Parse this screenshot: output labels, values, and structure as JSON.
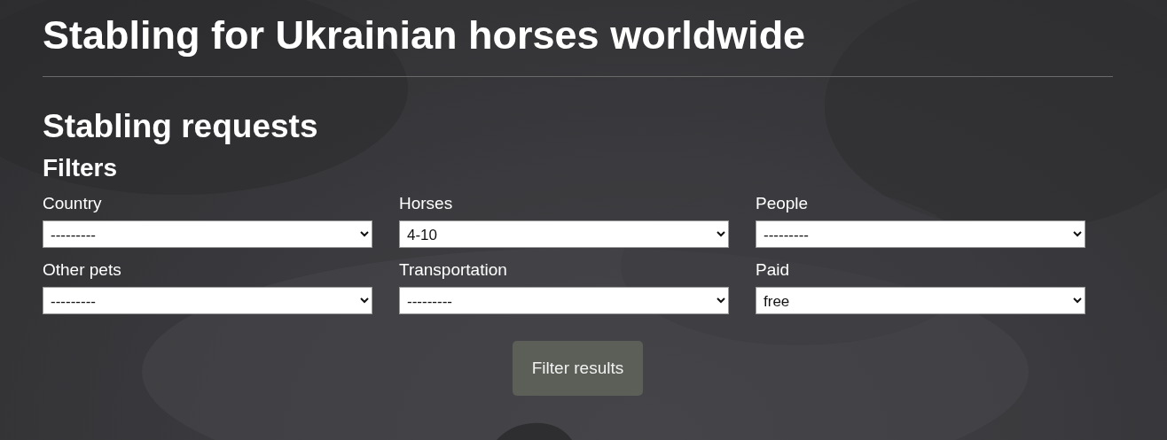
{
  "site_title": "Stabling for Ukrainian horses worldwide",
  "page_heading": "Stabling requests",
  "filters": {
    "heading": "Filters",
    "fields": [
      {
        "label": "Country",
        "value": "---------"
      },
      {
        "label": "Horses",
        "value": "4-10"
      },
      {
        "label": "People",
        "value": "---------"
      },
      {
        "label": "Other pets",
        "value": "---------"
      },
      {
        "label": "Transportation",
        "value": "---------"
      },
      {
        "label": "Paid",
        "value": "free"
      }
    ],
    "button": "Filter results"
  }
}
